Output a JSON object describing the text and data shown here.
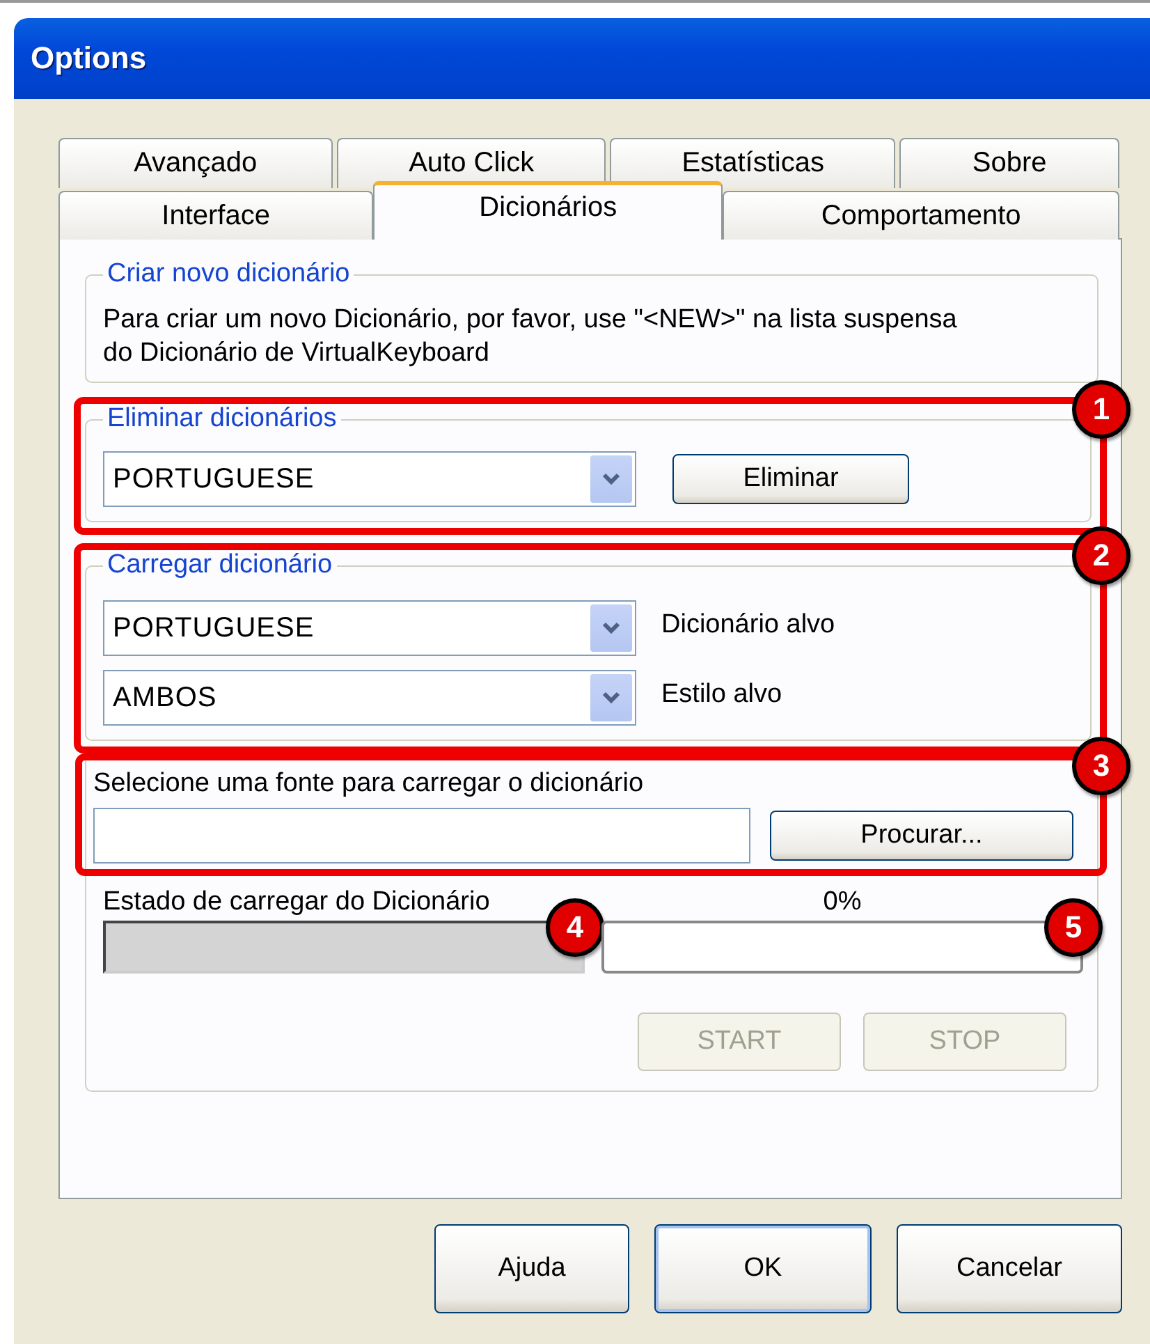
{
  "window": {
    "title": "Options"
  },
  "tabs": {
    "rows": [
      {
        "tabs": [
          {
            "label": "Avançado",
            "selected": false
          },
          {
            "label": "Auto Click",
            "selected": false
          },
          {
            "label": "Estatísticas",
            "selected": false
          },
          {
            "label": "Sobre",
            "selected": false
          }
        ]
      },
      {
        "tabs": [
          {
            "label": "Interface",
            "selected": false
          },
          {
            "label": "Dicionários",
            "selected": true
          },
          {
            "label": "Comportamento",
            "selected": false
          }
        ]
      }
    ]
  },
  "create_group": {
    "title": "Criar novo dicionário",
    "text": "Para criar um novo Dicionário, por favor, use \"<NEW>\" na lista suspensa do Dicionário de VirtualKeyboard"
  },
  "delete_group": {
    "title": "Eliminar dicionários",
    "callout": "1",
    "dropdown": {
      "value": "PORTUGUESE"
    },
    "button": "Eliminar"
  },
  "load_group": {
    "title": "Carregar dicionário",
    "callout": "2",
    "fields": [
      {
        "value": "PORTUGUESE",
        "label": "Dicionário alvo"
      },
      {
        "value": "AMBOS",
        "label": "Estilo alvo"
      }
    ]
  },
  "source_group": {
    "callout": "3",
    "label": "Selecione uma fonte para carregar o dicionário",
    "button": "Procurar..."
  },
  "status": {
    "label": "Estado de carregar do Dicionário",
    "percent": "0%",
    "field_callout": "4",
    "progress": {
      "level": 0,
      "callout": "5"
    }
  },
  "action_buttons": [
    {
      "label": "START",
      "disabled": true
    },
    {
      "label": "STOP",
      "disabled": true
    }
  ],
  "buttons": [
    {
      "label": "Ajuda",
      "default": false
    },
    {
      "label": "OK",
      "default": true
    },
    {
      "label": "Cancelar",
      "default": false
    }
  ]
}
